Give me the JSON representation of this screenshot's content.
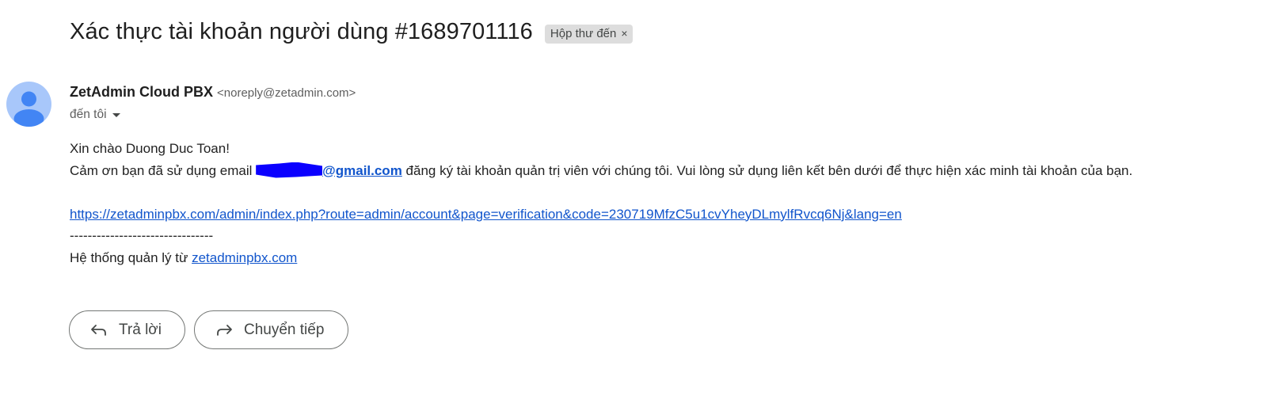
{
  "email": {
    "subject": "Xác thực tài khoản người dùng #1689701116",
    "label": "Hộp thư đến",
    "label_remove": "×",
    "sender_name": "ZetAdmin Cloud PBX",
    "sender_email": "<noreply@zetadmin.com>",
    "recipient": "đến tôi",
    "body": {
      "greeting": "Xin chào Duong Duc Toan!",
      "line2_prefix": "Cảm ơn bạn đã sử dụng email ",
      "line2_email_domain": "@gmail.com",
      "line2_suffix": " đăng ký tài khoản quản trị viên với chúng tôi. Vui lòng sử dụng liên kết bên dưới để thực hiện xác minh tài khoản của bạn.",
      "verification_link": "https://zetadminpbx.com/admin/index.php?route=admin/account&page=verification&code=230719MfzC5u1cvYheyDLmylfRvcq6Nj&lang=en",
      "separator": "--------------------------------",
      "footer_prefix": "Hệ thống quản lý từ ",
      "footer_link": "zetadminpbx.com"
    }
  },
  "actions": {
    "reply_label": "Trả lời",
    "forward_label": "Chuyển tiếp"
  },
  "icons": {
    "avatar": "default-person-avatar-icon",
    "reply": "reply-arrow-icon",
    "forward": "forward-arrow-icon",
    "recipient_toggle": "caret-down-icon"
  },
  "colors": {
    "link": "#1155cc",
    "avatar_bg": "#a8c7fa",
    "avatar_fg": "#4285f4",
    "chip_bg": "#dddddd",
    "redaction": "#0b00ff"
  }
}
